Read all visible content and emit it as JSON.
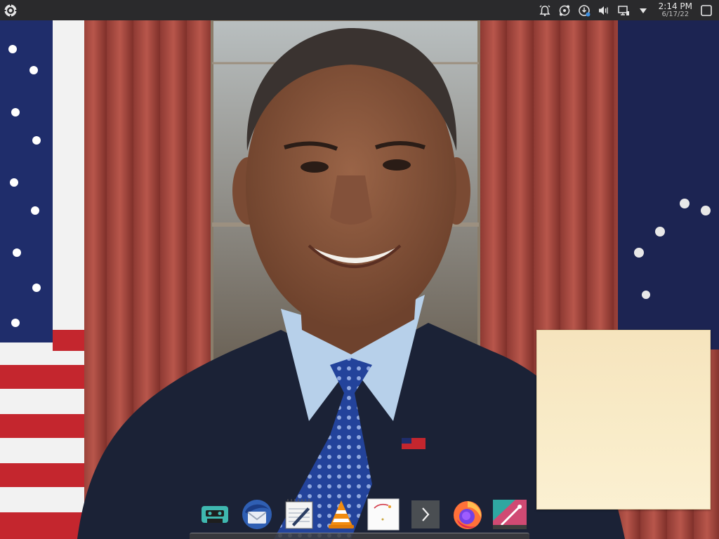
{
  "top_panel": {
    "clock": {
      "time": "2:14 PM",
      "date": "6/17/22"
    },
    "tray_icons": [
      "alarm-icon",
      "network-share-icon",
      "updates-icon",
      "volume-muted-icon",
      "network-wired-icon",
      "expand-tray-icon"
    ]
  },
  "dock": {
    "items": [
      "tape-recorder-icon",
      "thunderbird-mail-icon",
      "text-editor-icon",
      "vlc-player-icon",
      "image-viewer-icon",
      "terminal-icon",
      "firefox-browser-icon",
      "graphics-app-icon"
    ]
  },
  "colors": {
    "panel_bg": "#2a2a2c",
    "sticky_note_bg": "#f8eac6"
  }
}
